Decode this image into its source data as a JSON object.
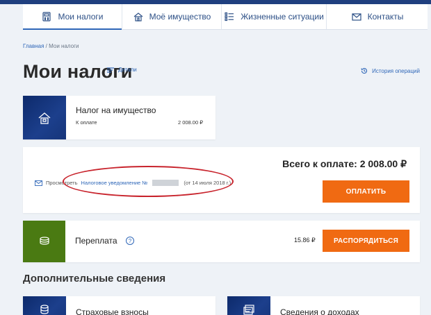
{
  "nav": {
    "items": [
      {
        "label": "Мои налоги",
        "icon": "calculator-icon",
        "active": true
      },
      {
        "label": "Моё имущество",
        "icon": "house-icon",
        "active": false
      },
      {
        "label": "Жизненные ситуации",
        "icon": "checklist-icon",
        "active": false
      },
      {
        "label": "Контакты",
        "icon": "envelope-icon",
        "active": false
      }
    ]
  },
  "breadcrumb": {
    "home": "Главная",
    "separator": " / ",
    "current": "Мои налоги"
  },
  "page": {
    "title": "Мои налоги",
    "details_label": "Детали",
    "history_label": "История операций"
  },
  "property_tax": {
    "title": "Налог на имущество",
    "pay_label": "К оплате",
    "amount": "2 008.00 ₽"
  },
  "total": {
    "label": "Всего к оплате: 2 008.00 ₽",
    "notice_prefix": "Просмотреть",
    "notice_link": "Налоговое уведомление №",
    "notice_date": "(от 14 июля 2018 г.)",
    "pay_button": "ОПЛАТИТЬ"
  },
  "overpayment": {
    "title": "Переплата",
    "help": "?",
    "amount": "15.86 ₽",
    "button": "РАСПОРЯДИТЬСЯ"
  },
  "additional": {
    "title": "Дополнительные сведения",
    "cards": [
      {
        "title": "Страховые взносы"
      },
      {
        "title": "Сведения о доходах"
      }
    ]
  },
  "colors": {
    "accent": "#2f67b8",
    "button": "#f06a12",
    "dark_blue": "#16357a",
    "green": "#4a7a12",
    "highlight_red": "#c8232c"
  }
}
